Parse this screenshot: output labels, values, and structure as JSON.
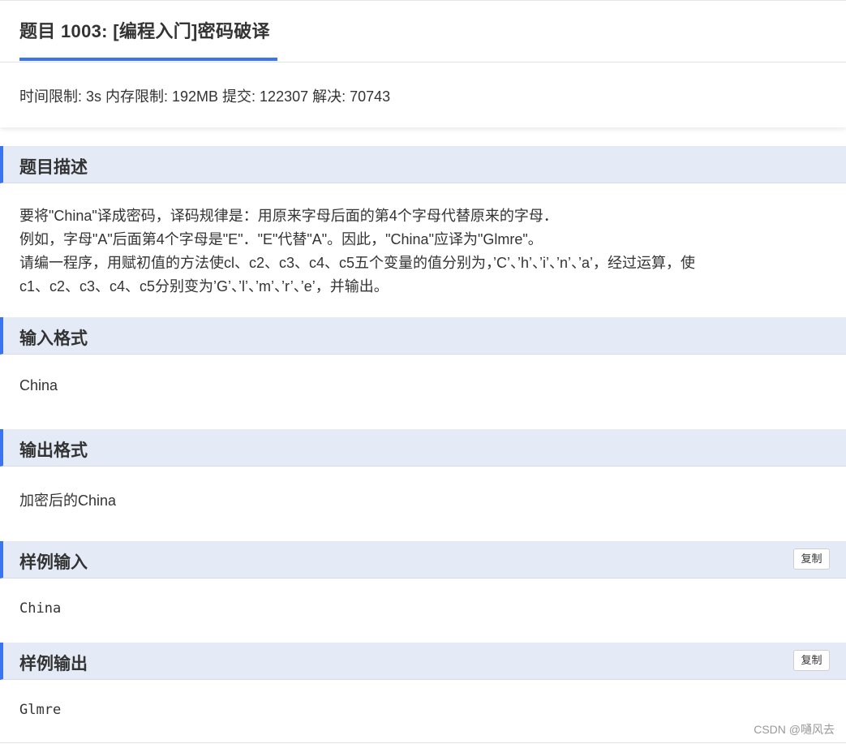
{
  "problem": {
    "title": "题目 1003: [编程入门]密码破译",
    "meta": "时间限制: 3s 内存限制: 192MB 提交: 122307 解决: 70743"
  },
  "sections": {
    "description": {
      "heading": "题目描述",
      "lines": [
        "要将\"China\"译成密码，译码规律是：用原来字母后面的第4个字母代替原来的字母．",
        "例如，字母\"A\"后面第4个字母是\"E\"．\"E\"代替\"A\"。因此，\"China\"应译为\"Glmre\"。",
        "请编一程序，用赋初值的方法使cl、c2、c3、c4、c5五个变量的值分别为，’C’、’h’、’i’、’n’、’a’，经过运算，使",
        "c1、c2、c3、c4、c5分别变为’G’、’l’、’m’、’r’、’e’，并输出。"
      ]
    },
    "input_format": {
      "heading": "输入格式",
      "text": "China"
    },
    "output_format": {
      "heading": "输出格式",
      "text": "加密后的China"
    },
    "sample_input": {
      "heading": "样例输入",
      "copy_label": "复制",
      "text": "China"
    },
    "sample_output": {
      "heading": "样例输出",
      "copy_label": "复制",
      "text": "Glmre"
    }
  },
  "watermark": "CSDN @嗵风去",
  "colors": {
    "accent": "#3b74f0",
    "section_bg": "#e4ebf7",
    "text": "#333333"
  }
}
